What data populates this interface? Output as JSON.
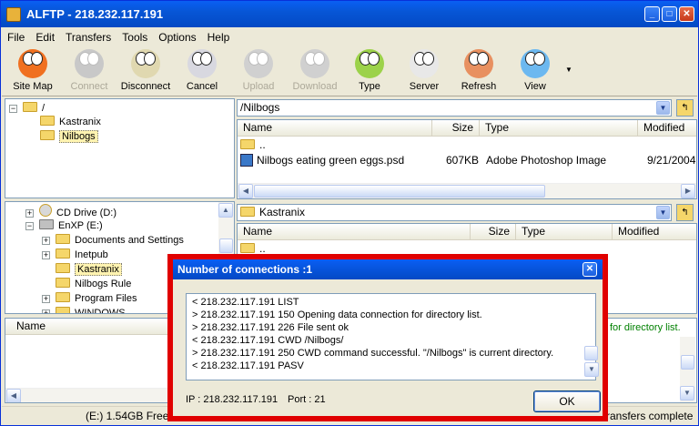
{
  "window": {
    "title": "ALFTP - 218.232.117.191"
  },
  "menu": [
    "File",
    "Edit",
    "Transfers",
    "Tools",
    "Options",
    "Help"
  ],
  "toolbar": [
    {
      "label": "Site Map",
      "icon": "site-map-icon",
      "enabled": true,
      "color": "#f07020"
    },
    {
      "label": "Connect",
      "icon": "connect-icon",
      "enabled": false,
      "color": "#c8c8c8"
    },
    {
      "label": "Disconnect",
      "icon": "disconnect-icon",
      "enabled": true,
      "color": "#e0d8b0"
    },
    {
      "label": "Cancel",
      "icon": "cancel-icon",
      "enabled": true,
      "color": "#d8d8e0"
    },
    {
      "label": "Upload",
      "icon": "upload-icon",
      "enabled": false,
      "color": "#d0d0d0"
    },
    {
      "label": "Download",
      "icon": "download-icon",
      "enabled": false,
      "color": "#d0d0d0"
    },
    {
      "label": "Type",
      "icon": "type-icon",
      "enabled": true,
      "color": "#9cd24a"
    },
    {
      "label": "Server",
      "icon": "server-icon",
      "enabled": true,
      "color": "#e8e8e8"
    },
    {
      "label": "Refresh",
      "icon": "refresh-icon",
      "enabled": true,
      "color": "#e89060"
    },
    {
      "label": "View",
      "icon": "view-icon",
      "enabled": true,
      "color": "#6cb8f0"
    }
  ],
  "remote_tree": {
    "root": "/",
    "items": [
      "Kastranix",
      "Nilbogs"
    ],
    "selected": "Nilbogs"
  },
  "local_tree": {
    "items": [
      {
        "label": "CD Drive (D:)",
        "kind": "cd",
        "exp": "+"
      },
      {
        "label": "EnXP (E:)",
        "kind": "drive",
        "exp": "−"
      },
      {
        "label": "Documents and Settings",
        "kind": "folder",
        "exp": "+"
      },
      {
        "label": "Inetpub",
        "kind": "folder",
        "exp": "+"
      },
      {
        "label": "Kastranix",
        "kind": "folder",
        "exp": ""
      },
      {
        "label": "Nilbogs Rule",
        "kind": "folder",
        "exp": ""
      },
      {
        "label": "Program Files",
        "kind": "folder",
        "exp": "+"
      },
      {
        "label": "WINDOWS",
        "kind": "folder",
        "exp": "+"
      }
    ],
    "selected": "Kastranix"
  },
  "remote_list": {
    "path": "/Nilbogs",
    "columns": [
      "Name",
      "Size",
      "Type",
      "Modified"
    ],
    "rows": [
      {
        "name": "..",
        "size": "",
        "type": "",
        "modified": ""
      },
      {
        "name": "Nilbogs eating green eggs.psd",
        "size": "607KB",
        "type": "Adobe Photoshop Image",
        "modified": "9/21/2004"
      }
    ]
  },
  "local_list": {
    "path": "Kastranix",
    "columns": [
      "Name",
      "Size",
      "Type",
      "Modified"
    ],
    "rows": [
      {
        "name": ".."
      }
    ]
  },
  "log_panel": {
    "header": "Name",
    "partial_text": "for directory list."
  },
  "status": {
    "drive": "(E:)  1.54GB Free",
    "transfers": "ransfers complete"
  },
  "dialog": {
    "title": "Number of connections :1",
    "log": [
      "< 218.232.117.191 LIST",
      "> 218.232.117.191 150 Opening data connection for directory list.",
      "> 218.232.117.191 226 File sent ok",
      "< 218.232.117.191 CWD /Nilbogs/",
      "> 218.232.117.191 250 CWD command successful. \"/Nilbogs\" is current directory.",
      "< 218.232.117.191 PASV"
    ],
    "ip_label": "IP : 218.232.117.191",
    "port_label": "Port : 21",
    "ok_label": "OK",
    "highlight_color": "#e00000"
  }
}
